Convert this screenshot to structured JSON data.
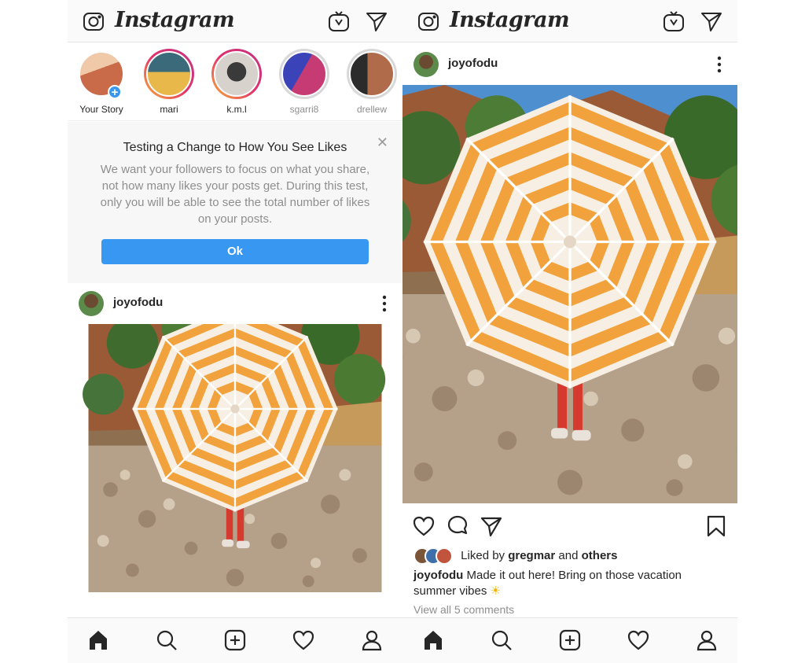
{
  "app": {
    "logo": "Instagram"
  },
  "header_icons": [
    "camera-icon",
    "igtv-icon",
    "direct-message-icon"
  ],
  "stories": [
    {
      "name": "Your Story",
      "state": "own",
      "colors": [
        "#c96a48",
        "#f0c9a8"
      ]
    },
    {
      "name": "mari",
      "state": "unseen",
      "colors": [
        "#e8b84b",
        "#3b6a7a"
      ]
    },
    {
      "name": "k.m.l",
      "state": "unseen",
      "colors": [
        "#d7d2cc",
        "#3a3a3a"
      ]
    },
    {
      "name": "sgarri8",
      "state": "seen",
      "colors": [
        "#c63b74",
        "#3a43b8"
      ]
    },
    {
      "name": "drellew",
      "state": "seen",
      "colors": [
        "#b06b4a",
        "#2b2b2b"
      ]
    }
  ],
  "notice": {
    "title": "Testing a Change to How You See Likes",
    "body": "We want your followers to focus on what you share, not how many likes your posts get. During this test, only you will be able to see the total number of likes on your posts.",
    "button": "Ok"
  },
  "post": {
    "username": "joyofodu",
    "liked_by_prefix": "Liked by",
    "liked_by_user": "gregmar",
    "liked_by_and": "and",
    "liked_by_others": "others",
    "caption_user": "joyofodu",
    "caption_text": "Made it out here! Bring on those vacation summer vibes",
    "caption_emoji": "☀",
    "view_comments": "View all 5 comments"
  },
  "post_actions": [
    "heart-icon",
    "comment-icon",
    "share-icon",
    "bookmark-icon"
  ],
  "bottom_nav": [
    "home-icon",
    "search-icon",
    "add-post-icon",
    "activity-heart-icon",
    "profile-icon"
  ],
  "colors": {
    "accent_blue": "#3897f0",
    "umbrella_orange": "#f2a23c",
    "sky": "#4e8fd0"
  }
}
